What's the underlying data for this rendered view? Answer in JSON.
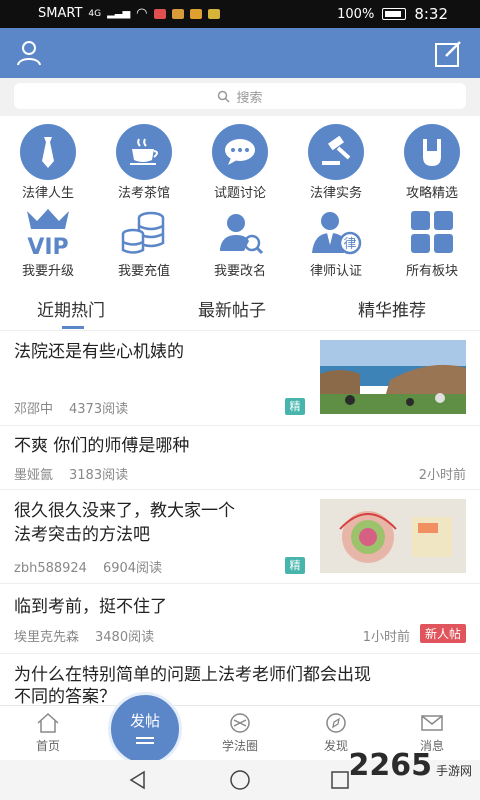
{
  "status_bar": {
    "carrier": "SMART",
    "network": "4G",
    "battery": "100%",
    "time": "8:32"
  },
  "header": {
    "left_icon": "user-icon",
    "right_icon": "edit-icon",
    "accent": "#5b86c8"
  },
  "search": {
    "placeholder": "搜索"
  },
  "categories": [
    {
      "label": "法律人生",
      "icon": "tie-icon"
    },
    {
      "label": "法考茶馆",
      "icon": "tea-cup-icon"
    },
    {
      "label": "试题讨论",
      "icon": "chat-bubble-icon"
    },
    {
      "label": "法律实务",
      "icon": "gavel-icon"
    },
    {
      "label": "攻略精选",
      "icon": "hand-gesture-icon"
    },
    {
      "label": "我要升级",
      "icon": "vip-crown-icon"
    },
    {
      "label": "我要充值",
      "icon": "coins-icon"
    },
    {
      "label": "我要改名",
      "icon": "rename-user-icon"
    },
    {
      "label": "律师认证",
      "icon": "lawyer-icon"
    },
    {
      "label": "所有板块",
      "icon": "grid-icon"
    }
  ],
  "tabs": [
    {
      "label": "近期热门",
      "active": true
    },
    {
      "label": "最新帖子",
      "active": false
    },
    {
      "label": "精华推荐",
      "active": false
    }
  ],
  "posts": [
    {
      "title": "法院还是有些心机婊的",
      "author": "邓邵中",
      "reads": "4373阅读",
      "badge": "精",
      "has_image": true
    },
    {
      "title": "不爽  你们的师傅是哪种",
      "author": "墨娅氤",
      "reads": "3183阅读",
      "time": "2小时前"
    },
    {
      "title_line1": "很久很久没来了，教大家一个",
      "title_line2": "法考突击的方法吧",
      "author": "zbh588924",
      "reads": "6904阅读",
      "badge": "精",
      "has_image": true
    },
    {
      "title": "临到考前，挺不住了",
      "author": "埃里克先森",
      "reads": "3480阅读",
      "time": "1小时前",
      "badge": "新人帖"
    },
    {
      "title_line1": "为什么在特别简单的问题上法考老师们都会出现",
      "title_line2": "不同的答案？"
    }
  ],
  "bottom_nav": {
    "home": "首页",
    "post": "发帖",
    "study": "学法圈",
    "discover": "发现",
    "messages": "消息"
  },
  "watermark": {
    "number": "2265",
    "text": "手游网"
  }
}
